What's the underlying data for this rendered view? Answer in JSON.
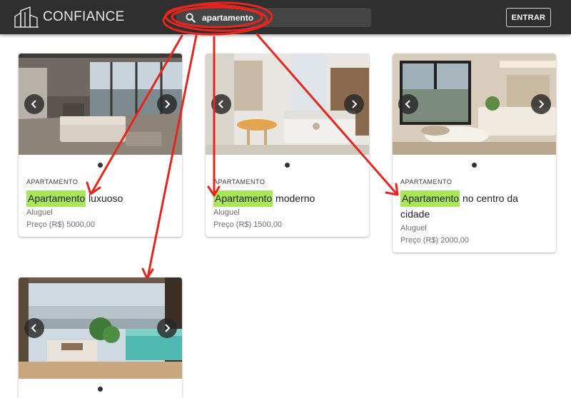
{
  "header": {
    "brand": "CONFIANCE",
    "search_value": "apartamento",
    "search_icon": "search-icon",
    "login_label": "ENTRAR"
  },
  "listings": [
    {
      "type_label": "APARTAMENTO",
      "title_highlight": "Apartamento",
      "title_rest": " luxuoso",
      "mode": "Aluguel",
      "price": "Preço (R$) 5000,00"
    },
    {
      "type_label": "APARTAMENTO",
      "title_highlight": "Apartamento",
      "title_rest": " moderno",
      "mode": "Aluguel",
      "price": "Preço (R$) 1500,00"
    },
    {
      "type_label": "APARTAMENTO",
      "title_highlight": "Apartamento",
      "title_rest": " no centro da cidade",
      "mode": "Aluguel",
      "price": "Preço (R$) 2000,00"
    },
    {
      "type_label": "",
      "title_highlight": "",
      "title_rest": "",
      "mode": "",
      "price": ""
    }
  ],
  "colors": {
    "topbar": "#2f2f2f",
    "search_bg": "#454545",
    "highlight": "#a8e65a",
    "annotation": "#e5261f"
  }
}
